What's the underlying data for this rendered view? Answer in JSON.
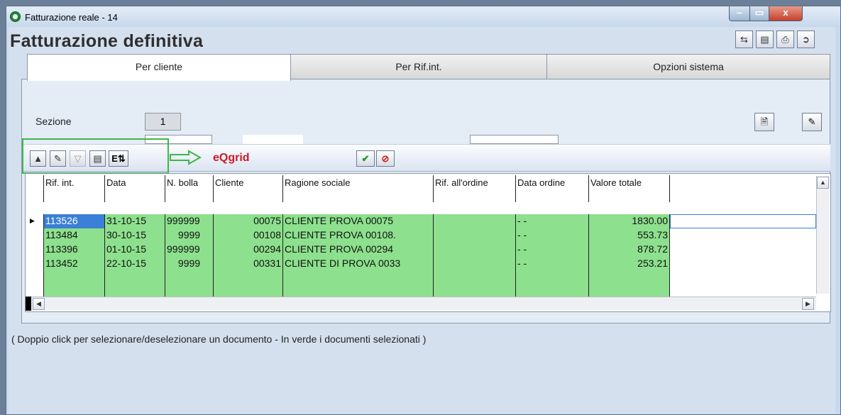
{
  "window": {
    "title": "Fatturazione reale - 14",
    "controls": {
      "minimize": "‒",
      "maximize": "▭",
      "close": "x"
    }
  },
  "page": {
    "heading": "Fatturazione definitiva",
    "toolbar_icons": [
      "refresh-icon",
      "copy-print-icon",
      "print-icon",
      "exit-door-icon"
    ]
  },
  "tabs": [
    {
      "label": "Per cliente",
      "active": true
    },
    {
      "label": "Per Rif.int.",
      "active": false
    },
    {
      "label": "Opzioni sistema",
      "active": false
    }
  ],
  "form": {
    "sezione_label": "Sezione",
    "sezione_value": "1"
  },
  "grid_toolbar": {
    "label": "eQgrid",
    "highlight_color": "#3fb64b",
    "buttons": [
      "scroll-up-icon",
      "edit-columns-icon",
      "filter-icon",
      "properties-icon",
      "export-excel-icon"
    ],
    "action_buttons": [
      "confirm-check-icon",
      "cancel-icon"
    ]
  },
  "grid": {
    "columns": [
      "Rif. int.",
      "Data",
      "N. bolla",
      "Cliente",
      "Ragione sociale",
      "Rif. all'ordine",
      "Data ordine",
      "Valore totale"
    ],
    "rows": [
      [
        "113526",
        "31-10-15",
        "999999",
        "00075",
        "CLIENTE PROVA 00075",
        "",
        "- -",
        "1830.00"
      ],
      [
        "113484",
        "30-10-15",
        "9999",
        "00108",
        "CLIENTE PROVA 00108.",
        "",
        "- -",
        "553.73"
      ],
      [
        "113396",
        "01-10-15",
        "999999",
        "00294",
        "CLIENTE PROVA 00294",
        "",
        "- -",
        "878.72"
      ],
      [
        "113452",
        "22-10-15",
        "9999",
        "00331",
        "CLIENTE DI PROVA 0033",
        "",
        "- -",
        "253.21"
      ]
    ],
    "selected_row_color": "#8de08d"
  },
  "hint": "( Doppio click per selezionare/deselezionare un documento - In verde i documenti selezionati )"
}
